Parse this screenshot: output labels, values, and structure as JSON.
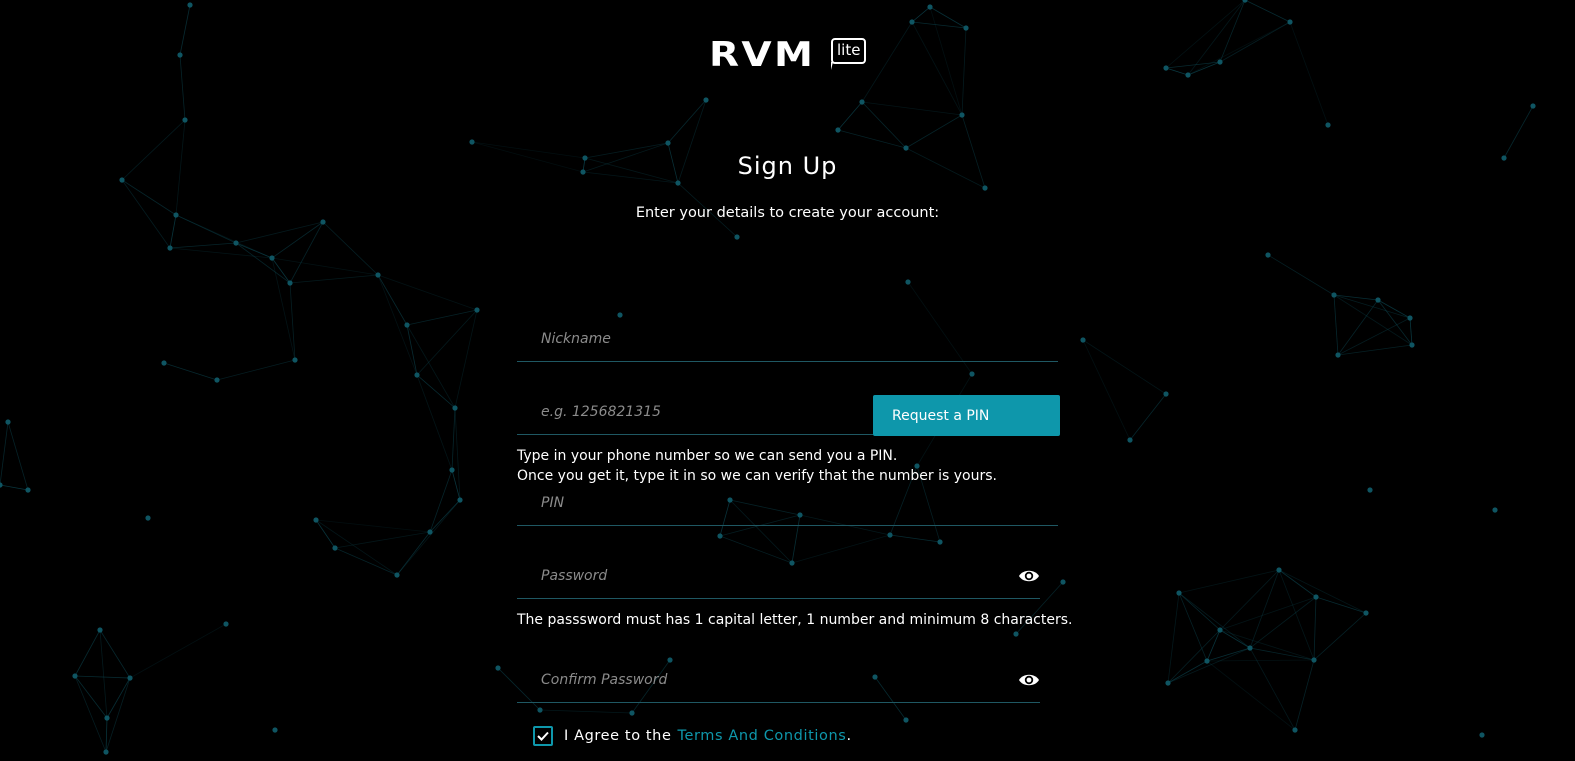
{
  "logo": {
    "text": "RVM",
    "badge": "lite"
  },
  "title": "Sign Up",
  "subtitle": "Enter your details to create your account:",
  "form": {
    "nickname": {
      "placeholder": "Nickname",
      "value": ""
    },
    "phone": {
      "placeholder": "e.g. 1256821315",
      "value": ""
    },
    "request_pin_label": "Request a PIN",
    "phone_help_line1": "Type in your phone number so we can send you a PIN.",
    "phone_help_line2": "Once you get it, type it in so we can verify that the number is yours.",
    "pin": {
      "placeholder": "PIN",
      "value": ""
    },
    "password": {
      "placeholder": "Password",
      "value": ""
    },
    "password_help": "The passsword must has 1 capital letter, 1 number and minimum 8 characters.",
    "confirm_password": {
      "placeholder": "Confirm Password",
      "value": ""
    },
    "agree_prefix": "I Agree to the",
    "terms_label": "Terms And Conditions",
    "agree_suffix": ".",
    "agree_checked": true
  },
  "colors": {
    "background": "#000000",
    "accent": "#0e97ab",
    "network_line": "#0d4a55",
    "field_underline": "#1f5863"
  },
  "icons": {
    "password_toggle": "eye-icon",
    "confirm_toggle": "eye-icon",
    "checkbox": "check-icon"
  }
}
